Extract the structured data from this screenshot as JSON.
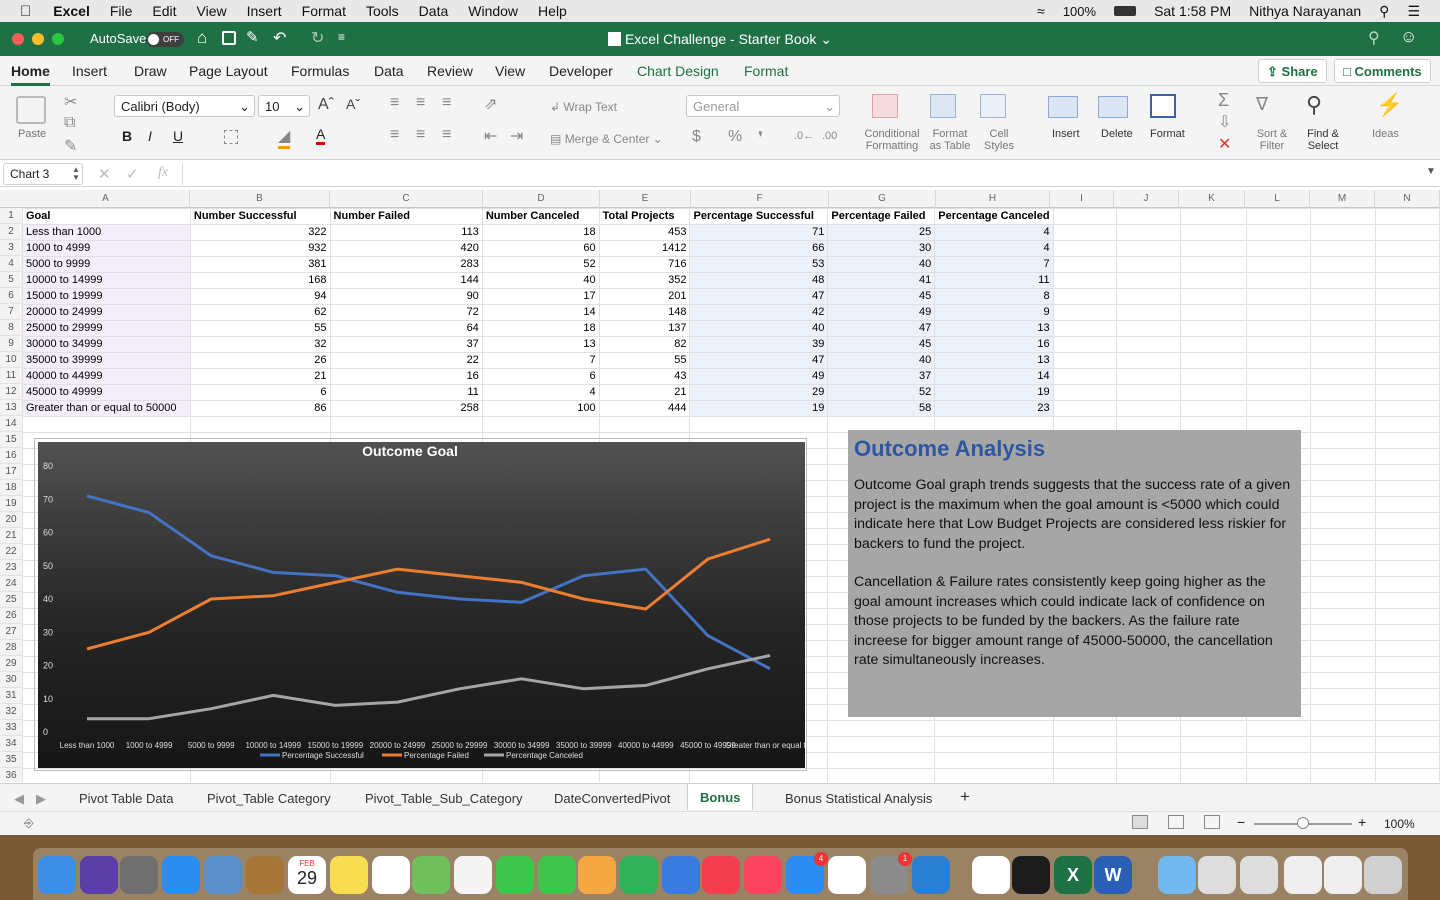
{
  "menubar": {
    "app_name": "Excel",
    "items": [
      "File",
      "Edit",
      "View",
      "Insert",
      "Format",
      "Tools",
      "Data",
      "Window",
      "Help"
    ],
    "battery": "100%",
    "clock": "Sat 1:58 PM",
    "user": "Nithya Narayanan"
  },
  "titlebar": {
    "autosave_label": "AutoSave",
    "autosave_state": "OFF",
    "document_title": "Excel Challenge - Starter Book"
  },
  "ribbon_tabs": [
    "Home",
    "Insert",
    "Draw",
    "Page Layout",
    "Formulas",
    "Data",
    "Review",
    "View",
    "Developer",
    "Chart Design",
    "Format"
  ],
  "share_label": "Share",
  "comments_label": "Comments",
  "ribbon": {
    "paste": "Paste",
    "font_name": "Calibri (Body)",
    "font_size": "10",
    "wrap_text": "Wrap Text",
    "merge_center": "Merge & Center",
    "number_format": "General",
    "conditional_formatting": "Conditional Formatting",
    "format_as_table": "Format as Table",
    "cell_styles": "Cell Styles",
    "insert": "Insert",
    "delete": "Delete",
    "format": "Format",
    "sort_filter": "Sort & Filter",
    "find_select": "Find & Select",
    "ideas": "Ideas"
  },
  "name_box": "Chart 3",
  "columns": [
    "A",
    "B",
    "C",
    "D",
    "E",
    "F",
    "G",
    "H",
    "I",
    "J",
    "K",
    "L",
    "M",
    "N"
  ],
  "row_numbers": [
    "1",
    "2",
    "3",
    "4",
    "5",
    "6",
    "7",
    "8",
    "9",
    "10",
    "11",
    "12",
    "13",
    "14",
    "15",
    "16",
    "17",
    "18",
    "19",
    "20",
    "21",
    "22",
    "23",
    "24",
    "25",
    "26",
    "27",
    "28",
    "29",
    "30",
    "31",
    "32",
    "33",
    "34",
    "35",
    "36",
    "37"
  ],
  "table": {
    "headers": [
      "Goal",
      "Number Successful",
      "Number Failed",
      "Number Canceled",
      "Total Projects",
      "Percentage Successful",
      "Percentage Failed",
      "Percentage Canceled"
    ],
    "rows": [
      [
        "Less than 1000",
        "322",
        "113",
        "18",
        "453",
        "71",
        "25",
        "4"
      ],
      [
        "1000 to 4999",
        "932",
        "420",
        "60",
        "1412",
        "66",
        "30",
        "4"
      ],
      [
        "5000 to 9999",
        "381",
        "283",
        "52",
        "716",
        "53",
        "40",
        "7"
      ],
      [
        "10000 to 14999",
        "168",
        "144",
        "40",
        "352",
        "48",
        "41",
        "11"
      ],
      [
        "15000 to 19999",
        "94",
        "90",
        "17",
        "201",
        "47",
        "45",
        "8"
      ],
      [
        "20000 to 24999",
        "62",
        "72",
        "14",
        "148",
        "42",
        "49",
        "9"
      ],
      [
        "25000 to 29999",
        "55",
        "64",
        "18",
        "137",
        "40",
        "47",
        "13"
      ],
      [
        "30000 to 34999",
        "32",
        "37",
        "13",
        "82",
        "39",
        "45",
        "16"
      ],
      [
        "35000 to 39999",
        "26",
        "22",
        "7",
        "55",
        "47",
        "40",
        "13"
      ],
      [
        "40000 to 44999",
        "21",
        "16",
        "6",
        "43",
        "49",
        "37",
        "14"
      ],
      [
        "45000 to 49999",
        "6",
        "11",
        "4",
        "21",
        "29",
        "52",
        "19"
      ],
      [
        "Greater than or equal to 50000",
        "86",
        "258",
        "100",
        "444",
        "19",
        "58",
        "23"
      ]
    ]
  },
  "chart_data": {
    "type": "line",
    "title": "Outcome Goal",
    "categories": [
      "Less than 1000",
      "1000 to 4999",
      "5000 to 9999",
      "10000 to 14999",
      "15000 to 19999",
      "20000 to 24999",
      "25000 to 29999",
      "30000 to 34999",
      "35000 to 39999",
      "40000 to 44999",
      "45000 to 49999",
      "Greater than or equal to 50000"
    ],
    "series": [
      {
        "name": "Percentage Successful",
        "color": "#4472c4",
        "values": [
          71,
          66,
          53,
          48,
          47,
          42,
          40,
          39,
          47,
          49,
          29,
          19
        ]
      },
      {
        "name": "Percentage Failed",
        "color": "#ed7d31",
        "values": [
          25,
          30,
          40,
          41,
          45,
          49,
          47,
          45,
          40,
          37,
          52,
          58
        ]
      },
      {
        "name": "Percentage Canceled",
        "color": "#a5a5a5",
        "values": [
          4,
          4,
          7,
          11,
          8,
          9,
          13,
          16,
          13,
          14,
          19,
          23
        ]
      }
    ],
    "ylim": [
      0,
      80
    ],
    "yticks": [
      "0",
      "10",
      "20",
      "30",
      "40",
      "50",
      "60",
      "70",
      "80"
    ],
    "legend": "bottom"
  },
  "analysis": {
    "title": "Outcome Analysis",
    "p1": "Outcome Goal graph trends suggests that the success rate of a given project is the maximum when the goal amount is <5000 which could indicate here that Low Budget Projects are considered less riskier for backers to fund the project.",
    "p2": "Cancellation & Failure rates consistently keep going higher as the goal amount increases which could indicate lack of confidence on those projects to be funded by the backers. As the failure rate increese for bigger amount range of 45000-50000, the cancellation rate simultaneously increases."
  },
  "sheet_tabs": [
    "Pivot Table Data",
    "Pivot_Table Category",
    "Pivot_Table_Sub_Category",
    "DateConvertedPivot",
    "Bonus",
    "Bonus Statistical Analysis"
  ],
  "active_sheet": "Bonus",
  "zoom": "100%",
  "dock": {
    "calendar_month": "FEB",
    "calendar_day": "29",
    "appstore_badge": "4",
    "settings_badge": "1"
  }
}
